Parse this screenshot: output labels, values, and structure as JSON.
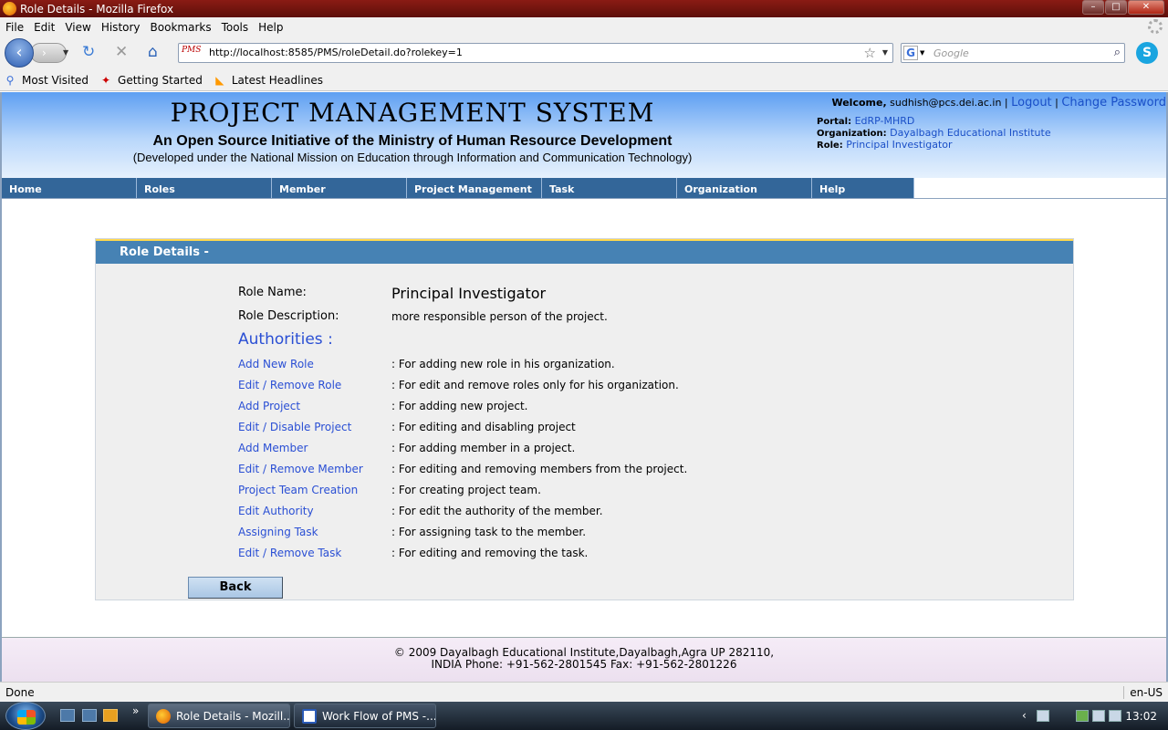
{
  "window": {
    "title": "Role Details - Mozilla Firefox",
    "controls": {
      "minimize": "–",
      "maximize": "□",
      "close": "✕"
    }
  },
  "menu": [
    "File",
    "Edit",
    "View",
    "History",
    "Bookmarks",
    "Tools",
    "Help"
  ],
  "navigation": {
    "url": "http://localhost:8585/PMS/roleDetail.do?rolekey=1",
    "favicon_text": "PMS",
    "search_placeholder": "Google",
    "search_engine_glyph": "G"
  },
  "bookmarks": [
    {
      "label": "Most Visited",
      "icon": "most-visited-icon"
    },
    {
      "label": "Getting Started",
      "icon": "getting-started-icon"
    },
    {
      "label": "Latest Headlines",
      "icon": "rss-icon"
    }
  ],
  "header": {
    "title": "PROJECT MANAGEMENT SYSTEM",
    "subtitle": "An Open Source Initiative of the Ministry of Human Resource Development",
    "subtitle2": "(Developed under the National Mission on Education through Information and Communication Technology)",
    "welcome_label": "Welcome,",
    "user_email": "sudhish@pcs.dei.ac.in",
    "logout": "Logout",
    "change_password": "Change Password",
    "portal_label": "Portal:",
    "portal": "EdRP-MHRD",
    "organization_label": "Organization:",
    "organization": "Dayalbagh Educational Institute",
    "role_label": "Role:",
    "role": "Principal Investigator"
  },
  "nav_tabs": [
    "Home",
    "Roles",
    "Member",
    "Project Management",
    "Task",
    "Organization",
    "Help"
  ],
  "panel": {
    "heading": "Role Details -",
    "role_name_label": "Role Name:",
    "role_name": "Principal Investigator",
    "role_desc_label": "Role Description:",
    "role_desc": "more responsible person of the project.",
    "authorities_label": "Authorities :",
    "authorities": [
      {
        "name": "Add New Role",
        "desc": ": For adding new role in his organization."
      },
      {
        "name": "Edit / Remove Role",
        "desc": ": For edit and remove roles only for his organization."
      },
      {
        "name": "Add Project",
        "desc": ": For adding new project."
      },
      {
        "name": "Edit / Disable Project",
        "desc": ": For editing and disabling project"
      },
      {
        "name": "Add Member",
        "desc": ": For adding member in a project."
      },
      {
        "name": "Edit / Remove Member",
        "desc": ": For editing and removing members from the project."
      },
      {
        "name": "Project Team Creation",
        "desc": ": For creating project team."
      },
      {
        "name": "Edit Authority",
        "desc": ": For edit the authority of the member."
      },
      {
        "name": "Assigning Task",
        "desc": ": For assigning task to the member."
      },
      {
        "name": "Edit / Remove Task",
        "desc": ": For editing and removing the task."
      }
    ],
    "back_button": "Back"
  },
  "footer": {
    "line1": "© 2009 Dayalbagh Educational Institute,Dayalbagh,Agra UP 282110,",
    "line2": "INDIA Phone: +91-562-2801545 Fax: +91-562-2801226"
  },
  "status": {
    "text": "Done",
    "locale": "en-US"
  },
  "taskbar": {
    "more": "»",
    "tasks": [
      {
        "label": "Role Details - Mozill...",
        "active": true
      },
      {
        "label": "Work Flow of PMS -...",
        "active": false
      }
    ],
    "tray_chevron": "‹",
    "clock": "13:02"
  },
  "colors": {
    "nav_tab": "#336699",
    "panel_head": "#4682b4",
    "link": "#2a4fd4",
    "titlebar": "#7a1810"
  }
}
